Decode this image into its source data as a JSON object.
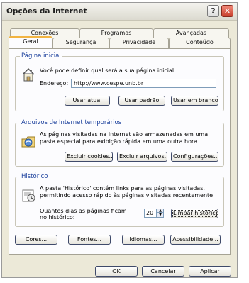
{
  "window": {
    "title": "Opções da Internet",
    "help_glyph": "?",
    "close_glyph": "✕"
  },
  "tabs": {
    "back_row": [
      "Conexões",
      "Programas",
      "Avançadas"
    ],
    "front_row": [
      "Geral",
      "Segurança",
      "Privacidade",
      "Conteúdo"
    ],
    "selected": "Geral"
  },
  "home_page": {
    "legend": "Página inicial",
    "description": "Você pode definir qual será a sua página inicial.",
    "address_label": "Endereço:",
    "address_value": "http://www.cespe.unb.br",
    "buttons": [
      "Usar atual",
      "Usar padrão",
      "Usar em branco"
    ]
  },
  "temp_files": {
    "legend": "Arquivos de Internet temporários",
    "description_line1": "As páginas visitadas na Internet são armazenadas em uma",
    "description_line2": "pasta especial para exibição rápida em uma outra hora.",
    "buttons": [
      "Excluir cookies...",
      "Excluir arquivos...",
      "Configurações..."
    ]
  },
  "history": {
    "legend": "Histórico",
    "description_line1": "A pasta 'Histórico' contém links para as páginas visitadas,",
    "description_line2": "permitindo acesso rápido às páginas visitadas recentemente.",
    "days_label_line1": "Quantos dias as páginas ficam",
    "days_label_line2": "no histórico:",
    "days_value": "20",
    "clear_button": "Limpar histórico"
  },
  "appearance_buttons": [
    "Cores...",
    "Fontes...",
    "Idiomas...",
    "Acessibilidade..."
  ],
  "dialog_buttons": [
    "OK",
    "Cancelar",
    "Aplicar"
  ],
  "icons": [
    "help-icon",
    "close-icon",
    "home-page-icon",
    "temp-files-icon",
    "history-icon",
    "spinner-up-icon",
    "spinner-down-icon"
  ]
}
